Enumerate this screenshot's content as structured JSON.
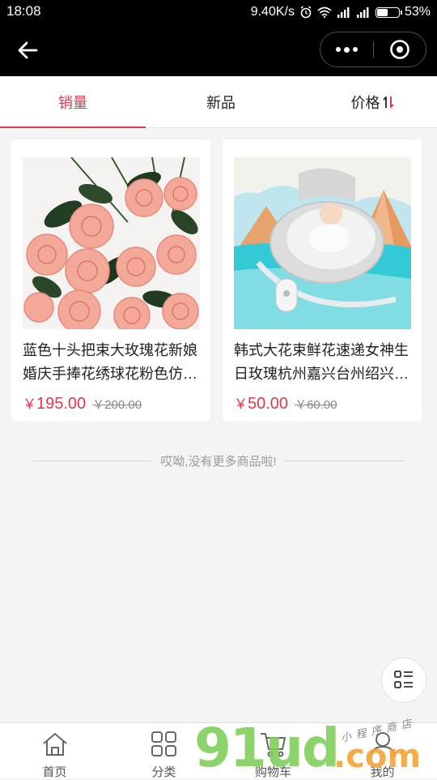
{
  "status_bar": {
    "time": "18:08",
    "speed": "9.40K/s",
    "battery": "53%",
    "battery_level": 0.53
  },
  "sort_tabs": [
    {
      "label": "销量",
      "active": true
    },
    {
      "label": "新品",
      "active": false
    },
    {
      "label": "价格",
      "active": false
    }
  ],
  "products": [
    {
      "title": "蓝色十头把束大玫瑰花新娘婚庆手捧花绣球花粉色仿真花",
      "currency": "￥",
      "price": "195.00",
      "original_price": "￥200.00"
    },
    {
      "title": "韩式大花束鲜花速递女神生日玫瑰杭州嘉兴台州绍兴鲜花",
      "currency": "￥",
      "price": "50.00",
      "original_price": "￥60.00"
    }
  ],
  "end_of_list": "哎呦,没有更多商品啦!",
  "tab_bar": [
    {
      "label": "首页",
      "icon": "home-icon"
    },
    {
      "label": "分类",
      "icon": "category-icon"
    },
    {
      "label": "购物车",
      "icon": "cart-icon"
    },
    {
      "label": "我的",
      "icon": "user-icon"
    }
  ],
  "watermark": {
    "main": "91ud",
    "domain": ".com",
    "tagline": "小程序商店"
  },
  "colors": {
    "accent": "#e0394b",
    "background": "#f4f4f4",
    "nav_background": "#000000"
  }
}
